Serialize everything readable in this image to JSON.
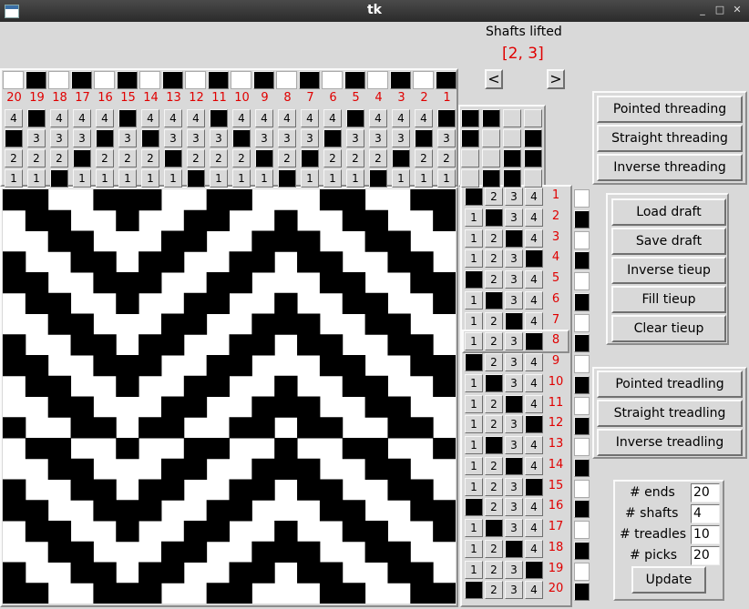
{
  "window": {
    "title": "tk"
  },
  "shafts_lifted": {
    "label": "Shafts lifted",
    "value": "[2, 3]",
    "prev_label": "<",
    "next_label": ">"
  },
  "ends": 20,
  "shafts": 4,
  "treadles": 10,
  "picks": 20,
  "threading": [
    4,
    3,
    2,
    1,
    4,
    3,
    2,
    1,
    2,
    3,
    4,
    1,
    2,
    3,
    4,
    3,
    2,
    1,
    4,
    3
  ],
  "warp_colors": [
    1,
    0,
    1,
    0,
    1,
    0,
    1,
    0,
    1,
    0,
    1,
    0,
    1,
    0,
    1,
    0,
    1,
    0,
    1,
    0
  ],
  "tieup": [
    [
      1,
      1,
      0,
      0
    ],
    [
      1,
      0,
      0,
      1
    ],
    [
      0,
      0,
      1,
      1
    ],
    [
      0,
      1,
      1,
      0
    ]
  ],
  "treadling": [
    1,
    2,
    3,
    4,
    1,
    2,
    3,
    4,
    1,
    2,
    3,
    4,
    2,
    3,
    4,
    1,
    2,
    3,
    4,
    1
  ],
  "current_pick": 8,
  "weft_colors": [
    1,
    0,
    1,
    0,
    1,
    0,
    1,
    0,
    1,
    0,
    1,
    0,
    1,
    0,
    1,
    0,
    1,
    0,
    1,
    0
  ],
  "threading_buttons": [
    "Pointed threading",
    "Straight threading",
    "Inverse threading"
  ],
  "file_buttons": [
    "Load draft",
    "Save draft",
    "Inverse tieup",
    "Fill tieup",
    "Clear tieup"
  ],
  "treadling_buttons": [
    "Pointed treadling",
    "Straight treadling",
    "Inverse treadling"
  ],
  "params": {
    "ends_label": "# ends",
    "ends_value": "20",
    "shafts_label": "# shafts",
    "shafts_value": "4",
    "treadles_label": "# treadles",
    "treadles_value": "10",
    "picks_label": "# picks",
    "picks_value": "20",
    "update_label": "Update"
  }
}
